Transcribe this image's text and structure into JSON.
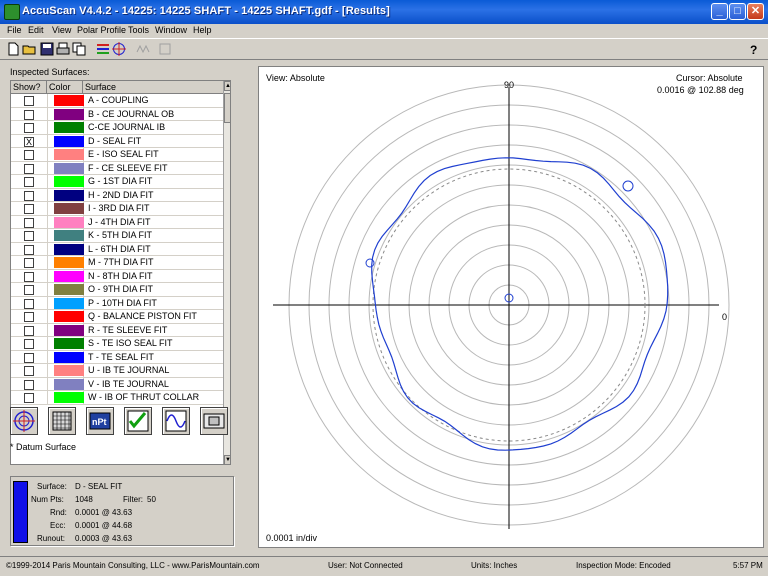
{
  "window": {
    "title": "AccuScan V4.4.2 - 14225: 14225 SHAFT - 14225 SHAFT.gdf - [Results]",
    "min": "_",
    "max": "□",
    "close": "✕"
  },
  "menu": [
    "File",
    "Edit",
    "View",
    "Polar Profile",
    "Tools",
    "Window",
    "Help"
  ],
  "left": {
    "inspected_label": "Inspected Surfaces:",
    "columns": [
      "Show?",
      "Color",
      "Surface"
    ],
    "surfaces": [
      {
        "checked": "",
        "color": "#ff0000",
        "name": "A - COUPLING"
      },
      {
        "checked": "",
        "color": "#800080",
        "name": "B - CE JOURNAL OB"
      },
      {
        "checked": "",
        "color": "#008000",
        "name": "C-CE JOURNAL IB"
      },
      {
        "checked": "X",
        "color": "#0000ff",
        "name": "D - SEAL FIT"
      },
      {
        "checked": "",
        "color": "#ff8080",
        "name": "E - ISO SEAL FIT"
      },
      {
        "checked": "",
        "color": "#8080c0",
        "name": "F - CE SLEEVE FIT"
      },
      {
        "checked": "",
        "color": "#00ff00",
        "name": "G - 1ST DIA FIT"
      },
      {
        "checked": "",
        "color": "#000080",
        "name": "H - 2ND DIA FIT"
      },
      {
        "checked": "",
        "color": "#804040",
        "name": "I - 3RD DIA FIT"
      },
      {
        "checked": "",
        "color": "#ff80c0",
        "name": "J - 4TH DIA FIT"
      },
      {
        "checked": "",
        "color": "#408080",
        "name": "K - 5TH DIA FIT"
      },
      {
        "checked": "",
        "color": "#000080",
        "name": "L - 6TH DIA FIT"
      },
      {
        "checked": "",
        "color": "#ff8000",
        "name": "M - 7TH DIA FIT"
      },
      {
        "checked": "",
        "color": "#ff00ff",
        "name": "N - 8TH DIA FIT"
      },
      {
        "checked": "",
        "color": "#808040",
        "name": "O - 9TH DIA FIT"
      },
      {
        "checked": "",
        "color": "#00a0ff",
        "name": "P - 10TH DIA FIT"
      },
      {
        "checked": "",
        "color": "#ff0000",
        "name": "Q - BALANCE PISTON FIT"
      },
      {
        "checked": "",
        "color": "#800080",
        "name": "R - TE SLEEVE FIT"
      },
      {
        "checked": "",
        "color": "#008000",
        "name": "S - TE ISO SEAL FIT"
      },
      {
        "checked": "",
        "color": "#0000ff",
        "name": "T - TE SEAL FIT"
      },
      {
        "checked": "",
        "color": "#ff8080",
        "name": "U - IB TE JOURNAL"
      },
      {
        "checked": "",
        "color": "#8080c0",
        "name": "V - IB TE JOURNAL"
      },
      {
        "checked": "",
        "color": "#00ff00",
        "name": "W - IB OF THRUT COLLAR"
      }
    ],
    "datum_note": "* Datum Surface",
    "tool_icons": [
      "polar-plot-icon",
      "grid-icon",
      "npt-icon",
      "checklist-icon",
      "waveform-icon",
      "report-icon"
    ],
    "npt_label": "nPt",
    "stats": {
      "color": "#1010e8",
      "surface_label": "Surface:",
      "surface_value": "D - SEAL FIT",
      "numpts_label": "Num Pts:",
      "numpts_value": "1048",
      "filter_label": "Filter:",
      "filter_value": "50",
      "rnd_label": "Rnd:",
      "rnd_value": "0.0001 @ 43.63",
      "ecc_label": "Ecc:",
      "ecc_value": "0.0001 @ 44.68",
      "runout_label": "Runout:",
      "runout_value": "0.0003 @ 43.63"
    }
  },
  "plot": {
    "view_label": "View: Absolute",
    "cursor_label": "Cursor: Absolute",
    "cursor_value": "0.0016 @ 102.88 deg",
    "angle_90": "90",
    "angle_0": "0",
    "scale_label": "0.0001 in/div",
    "trace_color": "#1f3fd0"
  },
  "status": {
    "copyright": "©1999-2014 Paris Mountain Consulting, LLC - www.ParisMountain.com",
    "user": "User: Not Connected",
    "units": "Units: Inches",
    "mode": "Inspection Mode: Encoded",
    "time": "5:57 PM"
  }
}
